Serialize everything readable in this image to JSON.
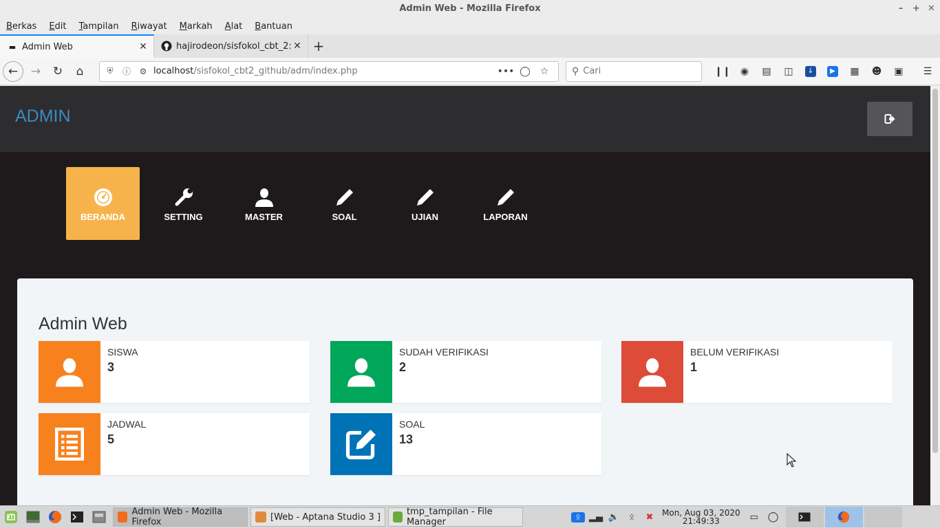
{
  "window": {
    "title": "Admin Web - Mozilla Firefox"
  },
  "menubar": {
    "items": [
      "Berkas",
      "Edit",
      "Tampilan",
      "Riwayat",
      "Markah",
      "Alat",
      "Bantuan"
    ]
  },
  "tabs": [
    {
      "title": "Admin Web",
      "icon": "page-icon",
      "active": true
    },
    {
      "title": "hajirodeon/sisfokol_cbt_2: sis",
      "icon": "github-icon",
      "active": false
    }
  ],
  "navbar": {
    "url_host": "localhost",
    "url_path": "/sisfokol_cbt2_github/adm/index.php",
    "search_placeholder": "Cari"
  },
  "site": {
    "brand": "ADMIN",
    "nav": [
      {
        "label": "BERANDA",
        "icon": "dashboard-icon",
        "active": true
      },
      {
        "label": "SETTING",
        "icon": "wrench-icon",
        "active": false
      },
      {
        "label": "MASTER",
        "icon": "user-icon",
        "active": false
      },
      {
        "label": "SOAL",
        "icon": "pencil-icon",
        "active": false
      },
      {
        "label": "UJIAN",
        "icon": "pencil-icon",
        "active": false
      },
      {
        "label": "LAPORAN",
        "icon": "pencil-icon",
        "active": false
      }
    ],
    "panel_title": "Admin Web",
    "cards": [
      {
        "label": "SISWA",
        "value": "3",
        "color": "#f7811d",
        "icon": "user-icon"
      },
      {
        "label": "SUDAH VERIFIKASI",
        "value": "2",
        "color": "#00a65a",
        "icon": "user-icon"
      },
      {
        "label": "BELUM VERIFIKASI",
        "value": "1",
        "color": "#dd4b39",
        "icon": "user-icon"
      },
      {
        "label": "JADWAL",
        "value": "5",
        "color": "#f7811d",
        "icon": "list-icon"
      },
      {
        "label": "SOAL",
        "value": "13",
        "color": "#0073b7",
        "icon": "edit-icon"
      }
    ],
    "accent": "#f7b34b",
    "brand_color": "#3a8ac4"
  },
  "taskbar": {
    "tasks": [
      {
        "title": "Admin Web - Mozilla Firefox",
        "active": true
      },
      {
        "title": "[Web - Aptana Studio 3 ]",
        "active": false
      },
      {
        "title": "tmp_tampilan - File Manager",
        "active": false
      }
    ],
    "clock_date": "Mon, Aug 03, 2020",
    "clock_time": "21:49:33"
  }
}
